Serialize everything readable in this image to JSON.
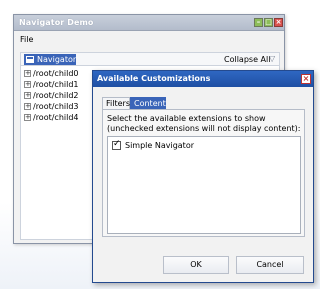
{
  "window": {
    "title": "Navigator Demo",
    "menu": {
      "file": "File"
    },
    "navigator": {
      "tab_label": "Navigator",
      "collapse_all": "Collapse All",
      "tree_items": [
        {
          "expander": "+",
          "label": "/root/child0"
        },
        {
          "expander": "+",
          "label": "/root/child1"
        },
        {
          "expander": "+",
          "label": "/root/child2"
        },
        {
          "expander": "+",
          "label": "/root/child3"
        },
        {
          "expander": "+",
          "label": "/root/child4"
        }
      ]
    }
  },
  "dialog": {
    "title": "Available Customizations",
    "tabs": [
      {
        "label": "Filters",
        "selected": false
      },
      {
        "label": "Content",
        "selected": true
      }
    ],
    "description": "Select the available extensions to show (unchecked extensions will not display content):",
    "extensions": [
      {
        "label": "Simple Navigator",
        "checked": true
      }
    ],
    "ok_label": "OK",
    "cancel_label": "Cancel"
  },
  "colors": {
    "dialog_title_bg": "#1f4fa3",
    "selected_tab_bg": "#3a64b8",
    "close_red": "#d9534f",
    "window_title_bg": "#b3bccb"
  }
}
